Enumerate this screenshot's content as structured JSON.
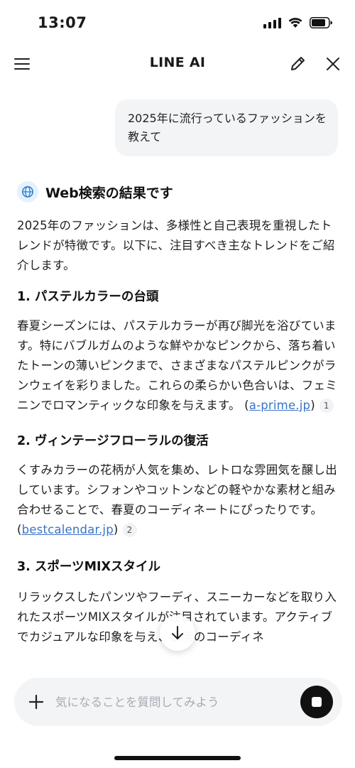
{
  "status_bar": {
    "time": "13:07",
    "icons": [
      "signal-icon",
      "wifi-icon",
      "battery-icon"
    ]
  },
  "header": {
    "title": "LINE AI",
    "icons": [
      "menu-icon",
      "edit-icon",
      "close-icon"
    ]
  },
  "user_message": {
    "text": "2025年に流行っているファッションを教えて"
  },
  "response": {
    "badge_icon": "globe-icon",
    "badge_title": "Web検索の結果です",
    "intro": "2025年のファッションは、多様性と自己表現を重視したトレンドが特徴です。以下に、注目すべき主なトレンドをご紹介します。",
    "sections": [
      {
        "heading": "1. パステルカラーの台頭",
        "body": "春夏シーズンには、パステルカラーが再び脚光を浴びています。特にバブルガムのような鮮やかなピンクから、落ち着いたトーンの薄いピンクまで、さまざまなパステルピンクがランウェイを彩りました。これらの柔らかい色合いは、フェミニンでロマンティックな印象を与えます。",
        "source_open": " (",
        "source": "a-prime.jp",
        "source_close": ")",
        "citation": "1"
      },
      {
        "heading": "2. ヴィンテージフローラルの復活",
        "body": "くすみカラーの花柄が人気を集め、レトロな雰囲気を醸し出しています。シフォンやコットンなどの軽やかな素材と組み合わせることで、春夏のコーディネートにぴったりです。",
        "source_open": " (",
        "source": "bestcalendar.jp",
        "source_close": ")",
        "citation": "2"
      },
      {
        "heading": "3. スポーツMIXスタイル",
        "body": "リラックスしたパンツやフーディ、スニーカーなどを取り入れたスポーツMIXスタイルが注目されています。アクティブでカジュアルな印象を与え、日常のコーディネ"
      }
    ]
  },
  "scroll_down_icon": "arrow-down-icon",
  "composer": {
    "plus_icon": "plus-icon",
    "placeholder": "気になることを質問してみよう",
    "value": "",
    "stop_icon": "stop-icon"
  },
  "colors": {
    "link": "#3a73c9",
    "bubble_bg": "#f3f4f6",
    "globe_bg": "#e6f1fb",
    "globe": "#2a7fd4",
    "stop_bg": "#111111"
  }
}
